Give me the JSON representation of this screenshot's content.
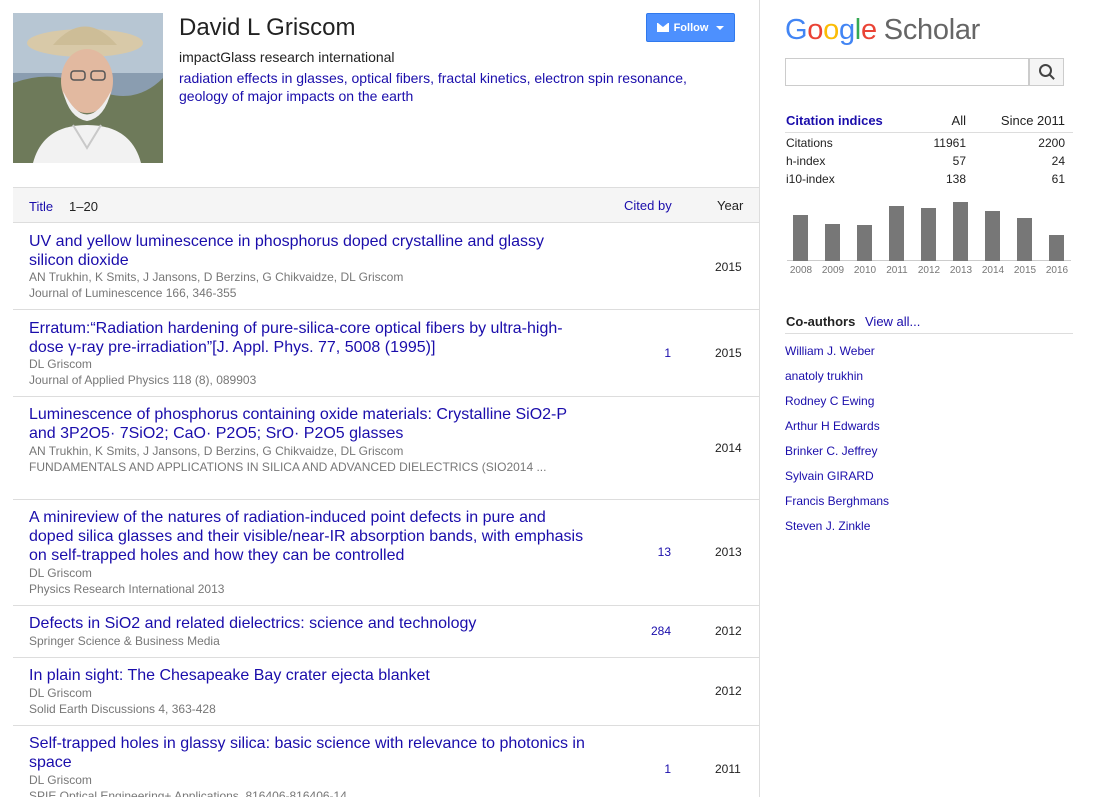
{
  "profile": {
    "name": "David L Griscom",
    "affiliation": "impactGlass research international",
    "interests_line1": "radiation effects in glasses, optical fibers, fractal kinetics, electron spin resonance,",
    "interests_line2": "geology of major impacts on the earth",
    "follow_label": "Follow"
  },
  "table": {
    "title_label": "Title",
    "range": "1–20",
    "cited_label": "Cited by",
    "year_label": "Year",
    "rows": [
      {
        "title": "UV and yellow luminescence in phosphorus doped crystalline and glassy silicon dioxide",
        "authors": "AN Trukhin, K Smits, J Jansons, D Berzins, G Chikvaidze, DL Griscom",
        "venue": "Journal of Luminescence 166, 346-355",
        "cited": "",
        "year": "2015"
      },
      {
        "title": "Erratum:“Radiation hardening of pure-silica-core optical fibers by ultra-high-dose γ-ray pre-irradiation”[J. Appl. Phys. 77, 5008 (1995)]",
        "authors": "DL Griscom",
        "venue": "Journal of Applied Physics 118 (8), 089903",
        "cited": "1",
        "year": "2015"
      },
      {
        "title": "Luminescence of phosphorus containing oxide materials: Crystalline SiO2-P and 3P2O5· 7SiO2; CaO· P2O5; SrO· P2O5 glasses",
        "authors": "AN Trukhin, K Smits, J Jansons, D Berzins, G Chikvaidze, DL Griscom",
        "venue": "FUNDAMENTALS AND APPLICATIONS IN SILICA AND ADVANCED DIELECTRICS (SIO2014 ...",
        "cited": "",
        "year": "2014"
      },
      {
        "title": "A minireview of the natures of radiation-induced point defects in pure and doped silica glasses and their visible/near-IR absorption bands, with emphasis on self-trapped holes and how they can be controlled",
        "authors": "DL Griscom",
        "venue": "Physics Research International 2013",
        "cited": "13",
        "year": "2013"
      },
      {
        "title": "Defects in SiO2 and related dielectrics: science and technology",
        "authors": "Springer Science & Business Media",
        "venue": "",
        "cited": "284",
        "year": "2012"
      },
      {
        "title": "In plain sight: The Chesapeake Bay crater ejecta blanket",
        "authors": "DL Griscom",
        "venue": "Solid Earth Discussions 4, 363-428",
        "cited": "",
        "year": "2012"
      },
      {
        "title": "Self-trapped holes in glassy silica: basic science with relevance to photonics in space",
        "authors": "DL Griscom",
        "venue": "SPIE Optical Engineering+ Applications, 816406-816406-14",
        "cited": "1",
        "year": "2011"
      }
    ]
  },
  "scholar": {
    "logo_google": [
      "G",
      "o",
      "o",
      "g",
      "l",
      "e"
    ],
    "logo_scholar": "Scholar",
    "search_placeholder": ""
  },
  "citation_indices": {
    "title": "Citation indices",
    "col_all": "All",
    "col_since": "Since 2011",
    "rows": [
      {
        "label": "Citations",
        "all": "11961",
        "since": "2200"
      },
      {
        "label": "h-index",
        "all": "57",
        "since": "24"
      },
      {
        "label": "i10-index",
        "all": "138",
        "since": "61"
      }
    ]
  },
  "chart_data": {
    "type": "bar",
    "categories": [
      "2008",
      "2009",
      "2010",
      "2011",
      "2012",
      "2013",
      "2014",
      "2015",
      "2016"
    ],
    "values": [
      440,
      350,
      340,
      520,
      500,
      560,
      480,
      410,
      250
    ],
    "ylim": [
      0,
      600
    ]
  },
  "coauthors": {
    "title": "Co-authors",
    "view_all": "View all...",
    "items": [
      "William J. Weber",
      "anatoly trukhin",
      "Rodney C Ewing",
      "Arthur H Edwards",
      "Brinker C. Jeffrey",
      "Sylvain GIRARD",
      "Francis Berghmans",
      "Steven J. Zinkle"
    ]
  },
  "colors": {
    "link": "#1a0dab",
    "button": "#4d90fe",
    "bar": "#777777"
  },
  "icons": {
    "photo": "profile-photo",
    "follow": "mail-icon",
    "search": "search-icon"
  }
}
